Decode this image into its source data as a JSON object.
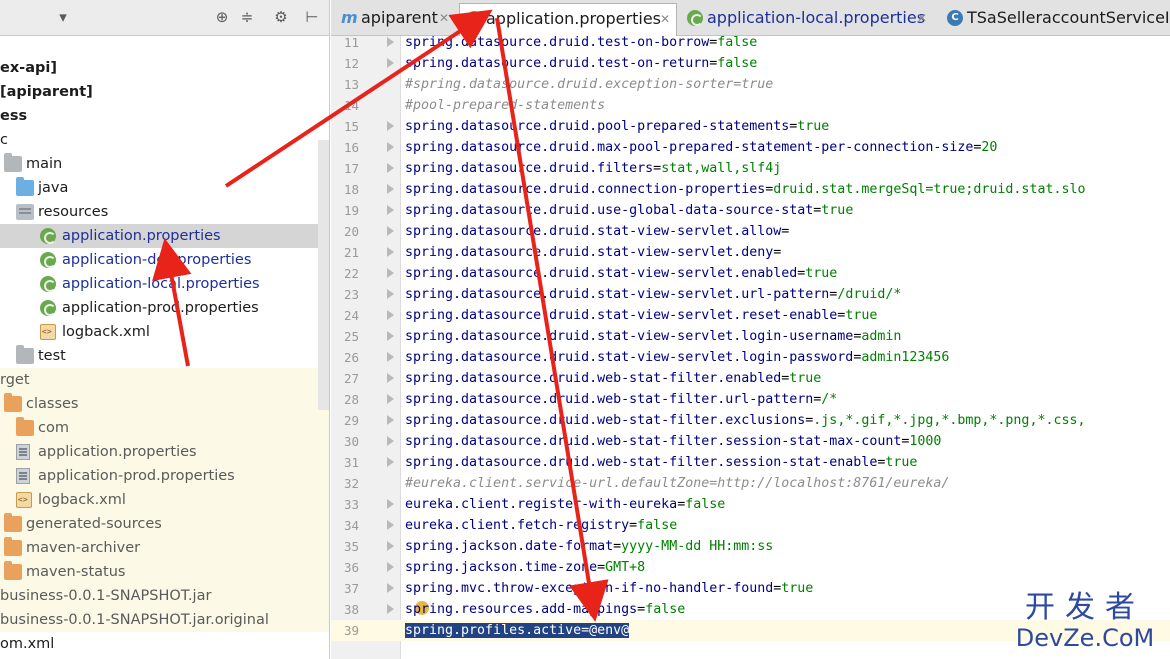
{
  "project_panel": {
    "toolbar": {
      "dropdown_icon": "chevron-down-icon",
      "target_icon": "crosshair-icon",
      "collapse_icon": "collapse-all-icon",
      "settings_icon": "gear-icon",
      "hide_icon": "hide-panel-icon"
    },
    "tree": [
      {
        "label": "ex-api]",
        "style": "bold",
        "icon": "none"
      },
      {
        "label": "[apiparent]",
        "style": "bold",
        "icon": "none"
      },
      {
        "label": "ess",
        "style": "bold",
        "icon": "none"
      },
      {
        "label": "c",
        "style": "normal",
        "icon": "none"
      },
      {
        "label": "main",
        "style": "normal",
        "icon": "folder-gray-icon"
      },
      {
        "label": "java",
        "style": "normal",
        "icon": "folder-blue-icon"
      },
      {
        "label": "resources",
        "style": "normal",
        "icon": "folder-resources-icon"
      },
      {
        "label": "application.properties",
        "style": "blue",
        "icon": "spring-leaf-icon",
        "selected": true
      },
      {
        "label": "application-dev.properties",
        "style": "blue",
        "icon": "spring-leaf-icon"
      },
      {
        "label": "application-local.properties",
        "style": "blue",
        "icon": "spring-leaf-icon"
      },
      {
        "label": "application-prod.properties",
        "style": "normal",
        "icon": "spring-leaf-icon"
      },
      {
        "label": "logback.xml",
        "style": "normal",
        "icon": "xml-file-icon"
      },
      {
        "label": "test",
        "style": "normal",
        "icon": "folder-gray-icon"
      },
      {
        "label": "rget",
        "style": "excluded",
        "icon": "none"
      },
      {
        "label": "classes",
        "style": "excluded",
        "icon": "folder-orange-icon"
      },
      {
        "label": "com",
        "style": "excluded",
        "icon": "folder-orange-icon"
      },
      {
        "label": "application.properties",
        "style": "excluded",
        "icon": "properties-file-icon"
      },
      {
        "label": "application-prod.properties",
        "style": "excluded",
        "icon": "properties-file-icon"
      },
      {
        "label": "logback.xml",
        "style": "excluded",
        "icon": "xml-file-icon"
      },
      {
        "label": "generated-sources",
        "style": "excluded",
        "icon": "folder-orange-icon"
      },
      {
        "label": "maven-archiver",
        "style": "excluded",
        "icon": "folder-orange-icon"
      },
      {
        "label": "maven-status",
        "style": "excluded",
        "icon": "folder-orange-icon"
      },
      {
        "label": "business-0.0.1-SNAPSHOT.jar",
        "style": "excluded",
        "icon": "none"
      },
      {
        "label": "business-0.0.1-SNAPSHOT.jar.original",
        "style": "excluded",
        "icon": "none"
      },
      {
        "label": "om.xml",
        "style": "normal",
        "icon": "none"
      }
    ]
  },
  "tabs": [
    {
      "label": "apiparent",
      "icon": "maven-icon",
      "active": false
    },
    {
      "label": "application.properties",
      "icon": "spring-leaf-icon",
      "active": true
    },
    {
      "label": "application-local.properties",
      "icon": "spring-leaf-icon",
      "active": false
    },
    {
      "label": "TSaSelleraccountServiceImp",
      "icon": "class-icon",
      "active": false
    }
  ],
  "editor": {
    "lines": [
      {
        "num": "11",
        "key": "spring.datasource.druid.test-on-borrow",
        "value": "false",
        "fold": true
      },
      {
        "num": "12",
        "key": "spring.datasource.druid.test-on-return",
        "value": "false",
        "fold": true
      },
      {
        "num": "13",
        "comment": "#spring.datasource.druid.exception-sorter=true"
      },
      {
        "num": "14",
        "comment": "#pool-prepared-statements"
      },
      {
        "num": "15",
        "key": "spring.datasource.druid.pool-prepared-statements",
        "value": "true",
        "fold": true
      },
      {
        "num": "16",
        "key": "spring.datasource.druid.max-pool-prepared-statement-per-connection-size",
        "value": "20",
        "fold": true
      },
      {
        "num": "17",
        "key": "spring.datasource.druid.filters",
        "value": "stat,wall,slf4j",
        "fold": true
      },
      {
        "num": "18",
        "key": "spring.datasource.druid.connection-properties",
        "value": "druid.stat.mergeSql=true;druid.stat.slo",
        "fold": true
      },
      {
        "num": "19",
        "key": "spring.datasource.druid.use-global-data-source-stat",
        "value": "true",
        "fold": true
      },
      {
        "num": "20",
        "key": "spring.datasource.druid.stat-view-servlet.allow",
        "value": "",
        "fold": true
      },
      {
        "num": "21",
        "key": "spring.datasource.druid.stat-view-servlet.deny",
        "value": "",
        "fold": true
      },
      {
        "num": "22",
        "key": "spring.datasource.druid.stat-view-servlet.enabled",
        "value": "true",
        "fold": true
      },
      {
        "num": "23",
        "key": "spring.datasource.druid.stat-view-servlet.url-pattern",
        "value": "/druid/*",
        "fold": true
      },
      {
        "num": "24",
        "key": "spring.datasource.druid.stat-view-servlet.reset-enable",
        "value": "true",
        "fold": true
      },
      {
        "num": "25",
        "key": "spring.datasource.druid.stat-view-servlet.login-username",
        "value": "admin",
        "fold": true
      },
      {
        "num": "26",
        "key": "spring.datasource.druid.stat-view-servlet.login-password",
        "value": "admin123456",
        "fold": true
      },
      {
        "num": "27",
        "key": "spring.datasource.druid.web-stat-filter.enabled",
        "value": "true",
        "fold": true
      },
      {
        "num": "28",
        "key": "spring.datasource.druid.web-stat-filter.url-pattern",
        "value": "/*",
        "fold": true
      },
      {
        "num": "29",
        "key": "spring.datasource.druid.web-stat-filter.exclusions",
        "value": ".js,*.gif,*.jpg,*.bmp,*.png,*.css,",
        "fold": true
      },
      {
        "num": "30",
        "key": "spring.datasource.druid.web-stat-filter.session-stat-max-count",
        "value": "1000",
        "fold": true
      },
      {
        "num": "31",
        "key": "spring.datasource.druid.web-stat-filter.session-stat-enable",
        "value": "true",
        "fold": true
      },
      {
        "num": "32",
        "comment": "#eureka.client.service-url.defaultZone=http://localhost:8761/eureka/"
      },
      {
        "num": "33",
        "key": "eureka.client.register-with-eureka",
        "value": "false",
        "fold": true
      },
      {
        "num": "34",
        "key": "eureka.client.fetch-registry",
        "value": "false",
        "fold": true
      },
      {
        "num": "35",
        "key": "spring.jackson.date-format",
        "value": "yyyy-MM-dd HH:mm:ss",
        "fold": true
      },
      {
        "num": "36",
        "key": "spring.jackson.time-zone",
        "value": "GMT+8",
        "fold": true
      },
      {
        "num": "37",
        "key": "spring.mvc.throw-exception-if-no-handler-found",
        "value": "true",
        "fold": true
      },
      {
        "num": "38",
        "key": "spring.resources.add-mappings",
        "value": "false",
        "fold": true,
        "bulb": true
      },
      {
        "num": "39",
        "selected_text": "spring.profiles.active=@env@",
        "current": true
      }
    ]
  },
  "watermark": {
    "cn": "开发者",
    "en": "DevZe.CoM"
  },
  "colors": {
    "annotation_arrow": "#e8231a",
    "key": "#000080",
    "value": "#008000",
    "comment": "#8c8c8c",
    "selection": "#214283"
  }
}
